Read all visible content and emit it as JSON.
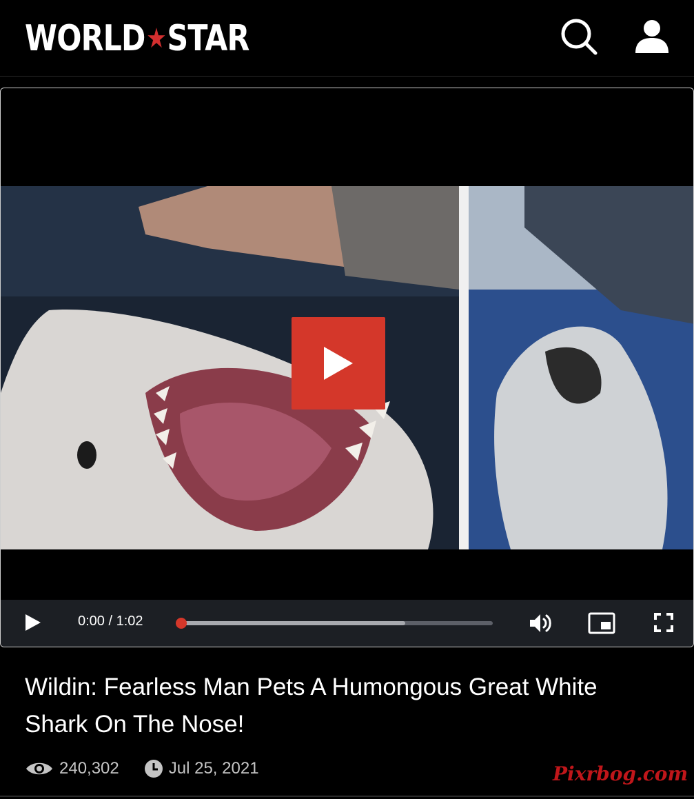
{
  "header": {
    "logo_left": "WORLD",
    "logo_right": "STAR",
    "icons": [
      "search-icon",
      "user-icon"
    ]
  },
  "video": {
    "current_time": "0:00",
    "duration": "1:02",
    "time_display": "0:00 / 1:02",
    "played_fraction": 0.0,
    "buffered_fraction": 0.72,
    "accent_color": "#d4372a",
    "controls": [
      "play-icon",
      "volume-icon",
      "picture-in-picture-icon",
      "fullscreen-icon"
    ]
  },
  "post": {
    "title": "Wildin: Fearless Man Pets A Humongous Great White Shark On The Nose!",
    "views": "240,302",
    "date": "Jul 25, 2021"
  },
  "watermark": "Pixrbog.com"
}
